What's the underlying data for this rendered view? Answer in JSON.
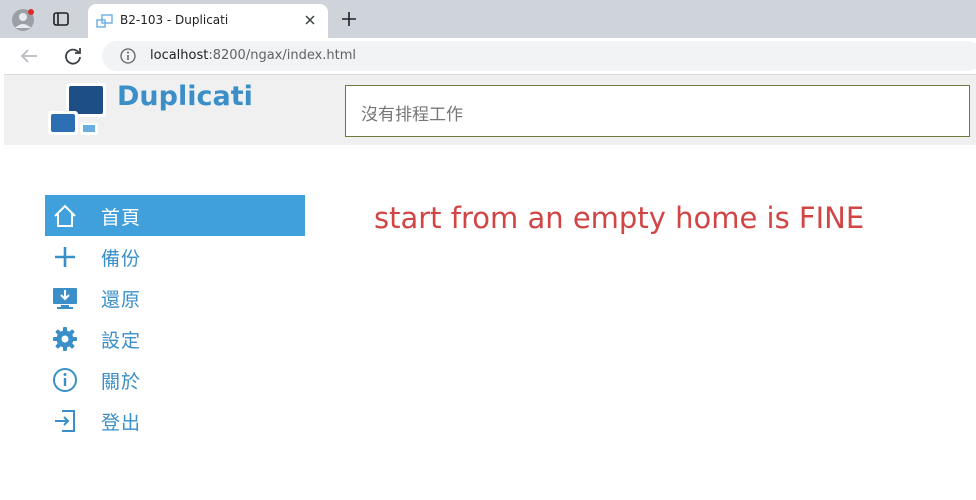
{
  "browser": {
    "tab_title": "B2-103 - Duplicati",
    "url_host": "localhost",
    "url_rest": ":8200/ngax/index.html"
  },
  "header": {
    "brand": "Duplicati",
    "schedule_text": "沒有排程工作"
  },
  "sidebar": {
    "items": [
      {
        "label": "首頁",
        "icon": "home-icon",
        "active": true
      },
      {
        "label": "備份",
        "icon": "plus-icon",
        "active": false
      },
      {
        "label": "還原",
        "icon": "restore-icon",
        "active": false
      },
      {
        "label": "設定",
        "icon": "gear-icon",
        "active": false
      },
      {
        "label": "關於",
        "icon": "info-icon",
        "active": false
      },
      {
        "label": "登出",
        "icon": "logout-icon",
        "active": false
      }
    ]
  },
  "main": {
    "message": "start from an empty home is FINE"
  },
  "colors": {
    "accent": "#3fa0dc",
    "link": "#3b8fc8",
    "message": "#d14545"
  }
}
